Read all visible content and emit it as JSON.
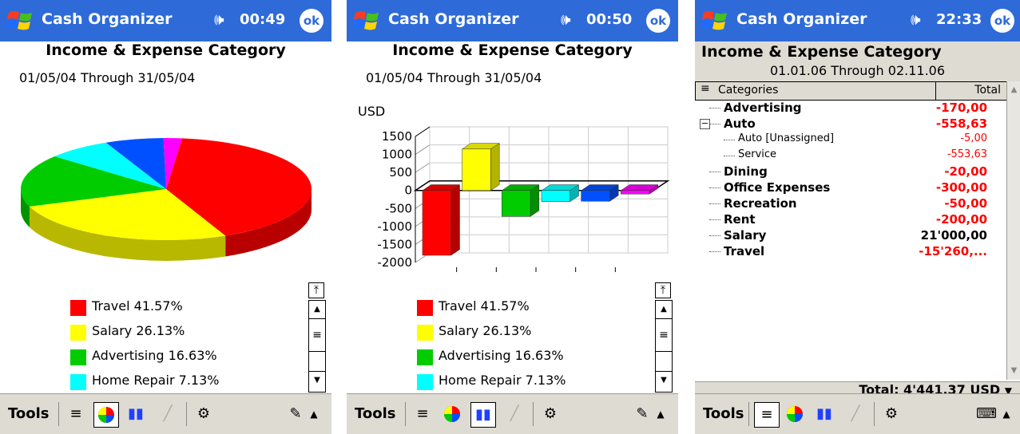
{
  "app_title": "Cash Organizer",
  "report_title": "Income & Expense Category",
  "toolbar_tools": "Tools",
  "ok_label": "ok",
  "colors": {
    "titlebar": "#2e6bd9",
    "negative": "#ff0000",
    "travel": "#ff0000",
    "salary": "#ffff00",
    "advertising": "#00cc00",
    "home_repair": "#00ffff",
    "blue": "#0050ff",
    "magenta": "#ff00ff"
  },
  "screens": [
    {
      "time": "00:49",
      "date_range": "01/05/04 Through 31/05/04",
      "view": "pie",
      "legend": [
        {
          "label": "Travel 41.57%",
          "color": "#ff0000",
          "pct": 41.57
        },
        {
          "label": "Salary 26.13%",
          "color": "#ffff00",
          "pct": 26.13
        },
        {
          "label": "Advertising 16.63%",
          "color": "#00cc00",
          "pct": 16.63
        },
        {
          "label": "Home Repair 7.13%",
          "color": "#00ffff",
          "pct": 7.13
        }
      ]
    },
    {
      "time": "00:50",
      "date_range": "01/05/04 Through 31/05/04",
      "view": "bar",
      "unit": "USD",
      "legend": [
        {
          "label": "Travel 41.57%",
          "color": "#ff0000"
        },
        {
          "label": "Salary 26.13%",
          "color": "#ffff00"
        },
        {
          "label": "Advertising 16.63%",
          "color": "#00cc00"
        },
        {
          "label": "Home Repair 7.13%",
          "color": "#00ffff"
        }
      ]
    },
    {
      "time": "22:33",
      "date_range": "01.01.06 Through 02.11.06",
      "view": "list",
      "header_categories": "Categories",
      "header_total": "Total",
      "total_line": "Total: 4'441,37 USD",
      "rows": [
        {
          "name": "Advertising",
          "value": "-170,00",
          "level": 0,
          "neg": true
        },
        {
          "name": "Auto",
          "value": "-558,63",
          "level": 0,
          "neg": true,
          "expand": "minus-icon"
        },
        {
          "name": "Auto [Unassigned]",
          "value": "-5,00",
          "level": 1,
          "neg": true
        },
        {
          "name": "Service",
          "value": "-553,63",
          "level": 1,
          "neg": true
        },
        {
          "name": "Dining",
          "value": "-20,00",
          "level": 0,
          "neg": true
        },
        {
          "name": "Office Expenses",
          "value": "-300,00",
          "level": 0,
          "neg": true
        },
        {
          "name": "Recreation",
          "value": "-50,00",
          "level": 0,
          "neg": true
        },
        {
          "name": "Rent",
          "value": "-200,00",
          "level": 0,
          "neg": true
        },
        {
          "name": "Salary",
          "value": "21'000,00",
          "level": 0,
          "neg": false
        },
        {
          "name": "Travel",
          "value": "-15'260,...",
          "level": 0,
          "neg": true
        }
      ]
    }
  ],
  "chart_data": [
    {
      "type": "pie",
      "title": "Income & Expense Category",
      "categories": [
        "Travel",
        "Salary",
        "Advertising",
        "Home Repair",
        "Blue slice",
        "Magenta slice"
      ],
      "values": [
        41.57,
        26.13,
        16.63,
        7.13,
        6.5,
        2.04
      ],
      "colors": [
        "#ff0000",
        "#ffff00",
        "#00cc00",
        "#00ffff",
        "#0050ff",
        "#ff00ff"
      ]
    },
    {
      "type": "bar",
      "title": "Income & Expense Category",
      "ylabel": "USD",
      "ylim": [
        -2000,
        1500
      ],
      "yticks": [
        1500,
        1000,
        500,
        0,
        -500,
        -1000,
        -1500,
        -2000
      ],
      "values": [
        -1800,
        1150,
        -720,
        -310,
        -300,
        -100
      ],
      "colors": [
        "#ff0000",
        "#ffff00",
        "#00cc00",
        "#00ffff",
        "#0050ff",
        "#ff00ff"
      ]
    }
  ]
}
